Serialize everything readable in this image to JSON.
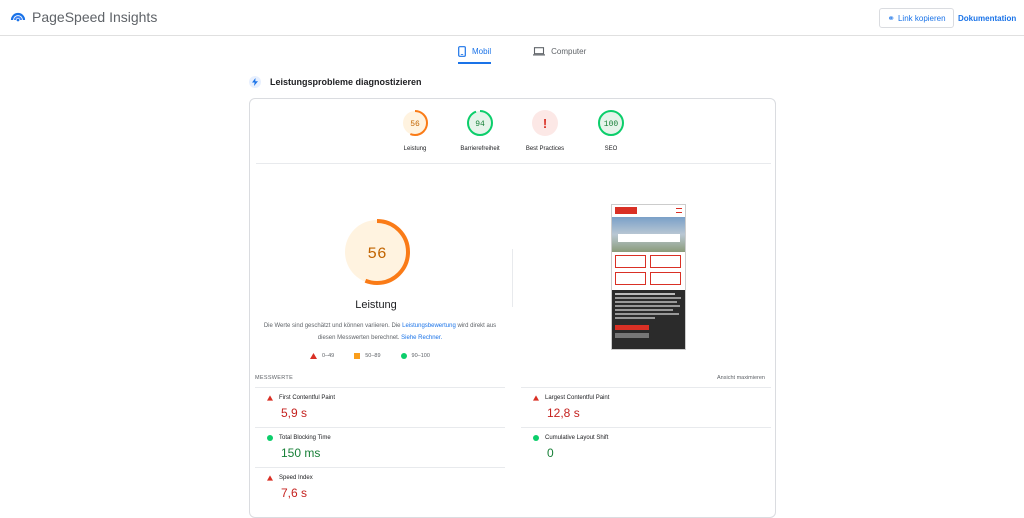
{
  "header": {
    "brand": "PageSpeed Insights",
    "copy_link_label": "Link kopieren",
    "docs_label": "Dokumentation"
  },
  "tabs": [
    {
      "label": "Mobil",
      "active": true,
      "icon": "phone-icon"
    },
    {
      "label": "Computer",
      "active": false,
      "icon": "laptop-icon"
    }
  ],
  "diagnose": {
    "title": "Leistungsprobleme diagnostizieren"
  },
  "gauges": [
    {
      "label": "Leistung",
      "score": "56",
      "fraction": 0.56,
      "color": "#fa7b17",
      "bg": "#fff3e0",
      "text_color": "#c26401"
    },
    {
      "label": "Barrierefreiheit",
      "score": "94",
      "fraction": 0.94,
      "color": "#0cce6b",
      "bg": "#e6f4ea",
      "text_color": "#188038"
    },
    {
      "label": "Best Practices",
      "score": "!",
      "fraction": 0,
      "color": "#d93025",
      "bg": "#fce8e6",
      "text_color": "#d93025"
    },
    {
      "label": "SEO",
      "score": "100",
      "fraction": 1.0,
      "color": "#0cce6b",
      "bg": "#e6f4ea",
      "text_color": "#188038"
    }
  ],
  "main_gauge": {
    "score": "56",
    "fraction": 0.56,
    "label": "Leistung",
    "color": "#fa7b17",
    "bg": "#fff3e0",
    "text_color": "#c26401"
  },
  "description": {
    "part1": "Die Werte sind geschätzt und können variieren. Die ",
    "link1": "Leistungsbewertung",
    "part2": " wird direkt aus diesen Messwerten berechnet. ",
    "link2": "Siehe Rechner."
  },
  "legend": [
    {
      "range": "0–49",
      "shape": "triangle",
      "color": "#d93025"
    },
    {
      "range": "50–89",
      "shape": "square",
      "color": "#fa9e1b"
    },
    {
      "range": "90–100",
      "shape": "circle",
      "color": "#0cce6b"
    }
  ],
  "metrics_header": {
    "title": "MESSWERTE",
    "expand": "Ansicht maximieren"
  },
  "metrics": [
    {
      "name": "First Contentful Paint",
      "value": "5,9 s",
      "status": "bad"
    },
    {
      "name": "Largest Contentful Paint",
      "value": "12,8 s",
      "status": "bad"
    },
    {
      "name": "Total Blocking Time",
      "value": "150 ms",
      "status": "good"
    },
    {
      "name": "Cumulative Layout Shift",
      "value": "0",
      "status": "good"
    },
    {
      "name": "Speed Index",
      "value": "7,6 s",
      "status": "bad"
    }
  ],
  "colors": {
    "accent": "#1a73e8",
    "bad": "#d93025",
    "good": "#0cce6b",
    "average": "#fa7b17"
  }
}
